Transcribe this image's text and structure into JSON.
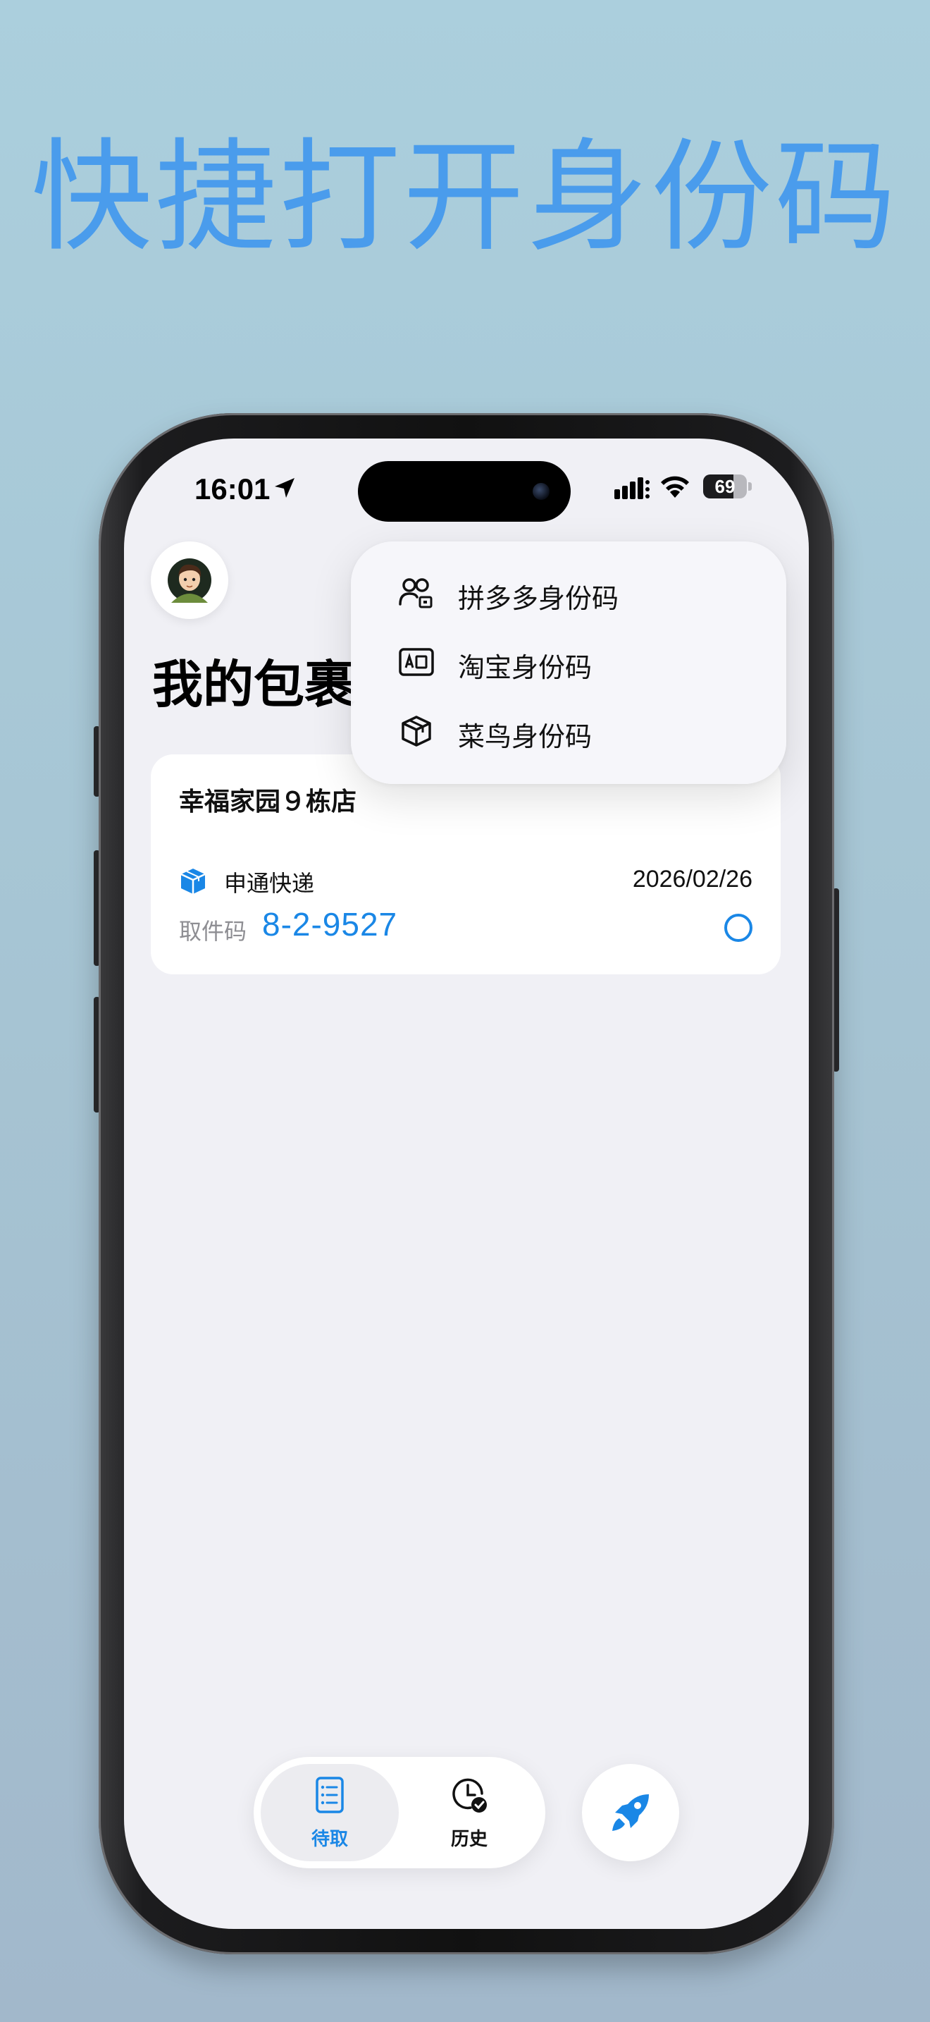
{
  "headline": "快捷打开身份码",
  "status_bar": {
    "time": "16:01",
    "battery_level": 69,
    "battery_text": "69"
  },
  "page": {
    "title": "我的包裹"
  },
  "package_card": {
    "store": "幸福家园９栋店",
    "carrier": "申通快递",
    "date": "2026/02/26",
    "code_label": "取件码",
    "code": "8-2-9527"
  },
  "menu": {
    "items": [
      {
        "label": "拼多多身份码",
        "icon": "people-qr-icon"
      },
      {
        "label": "淘宝身份码",
        "icon": "id-card-icon"
      },
      {
        "label": "菜鸟身份码",
        "icon": "package-box-icon"
      }
    ]
  },
  "tabbar": {
    "tabs": [
      {
        "label": "待取",
        "icon": "list-icon",
        "active": true
      },
      {
        "label": "历史",
        "icon": "clock-check-icon",
        "active": false
      }
    ],
    "fab_icon": "rocket-icon"
  },
  "colors": {
    "accent": "#1a87e6",
    "headline": "#4a9cec",
    "background": "#abcfdd"
  }
}
